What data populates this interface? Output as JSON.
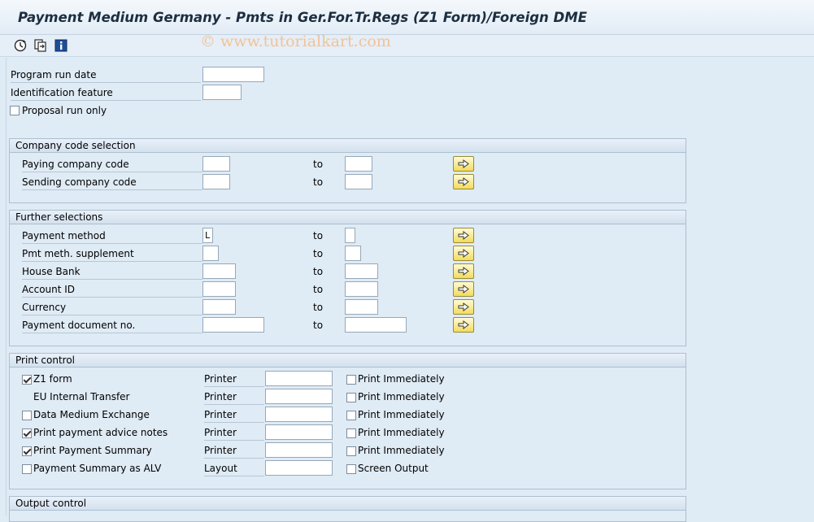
{
  "window": {
    "title": "Payment Medium Germany - Pmts in Ger.For.Tr.Regs (Z1 Form)/Foreign DME"
  },
  "watermark": "© www.tutorialkart.com",
  "toolbar": {
    "icons": [
      "execute-icon",
      "get-variant-icon",
      "info-icon"
    ]
  },
  "general": {
    "run_date_label": "Program run date",
    "run_date_value": "",
    "ident_label": "Identification feature",
    "ident_value": "",
    "proposal_label": "Proposal run only",
    "proposal_checked": false
  },
  "company": {
    "header": "Company code selection",
    "to_label": "to",
    "rows": [
      {
        "label": "Paying company code",
        "from": "",
        "to": ""
      },
      {
        "label": "Sending company code",
        "from": "",
        "to": ""
      }
    ]
  },
  "further": {
    "header": "Further selections",
    "to_label": "to",
    "rows": [
      {
        "label": "Payment method",
        "from": "L",
        "to": ""
      },
      {
        "label": "Pmt meth. supplement",
        "from": "",
        "to": ""
      },
      {
        "label": "House Bank",
        "from": "",
        "to": ""
      },
      {
        "label": "Account ID",
        "from": "",
        "to": ""
      },
      {
        "label": "Currency",
        "from": "",
        "to": ""
      },
      {
        "label": "Payment document no.",
        "from": "",
        "to": ""
      }
    ]
  },
  "print": {
    "header": "Print control",
    "rows": [
      {
        "label": "Z1 form",
        "checked": true,
        "has_check": true,
        "device_label": "Printer",
        "option_label": "Print Immediately",
        "option_checked": false
      },
      {
        "label": "EU Internal Transfer",
        "checked": false,
        "has_check": false,
        "device_label": "Printer",
        "option_label": "Print Immediately",
        "option_checked": false
      },
      {
        "label": "Data Medium Exchange",
        "checked": false,
        "has_check": true,
        "device_label": "Printer",
        "option_label": "Print Immediately",
        "option_checked": false
      },
      {
        "label": "Print payment advice notes",
        "checked": true,
        "has_check": true,
        "device_label": "Printer",
        "option_label": "Print Immediately",
        "option_checked": false
      },
      {
        "label": "Print Payment Summary",
        "checked": true,
        "has_check": true,
        "device_label": "Printer",
        "option_label": "Print Immediately",
        "option_checked": false
      },
      {
        "label": "Payment Summary as ALV",
        "checked": false,
        "has_check": true,
        "device_label": "Layout",
        "option_label": "Screen Output",
        "option_checked": false
      }
    ]
  },
  "output": {
    "header": "Output control"
  }
}
